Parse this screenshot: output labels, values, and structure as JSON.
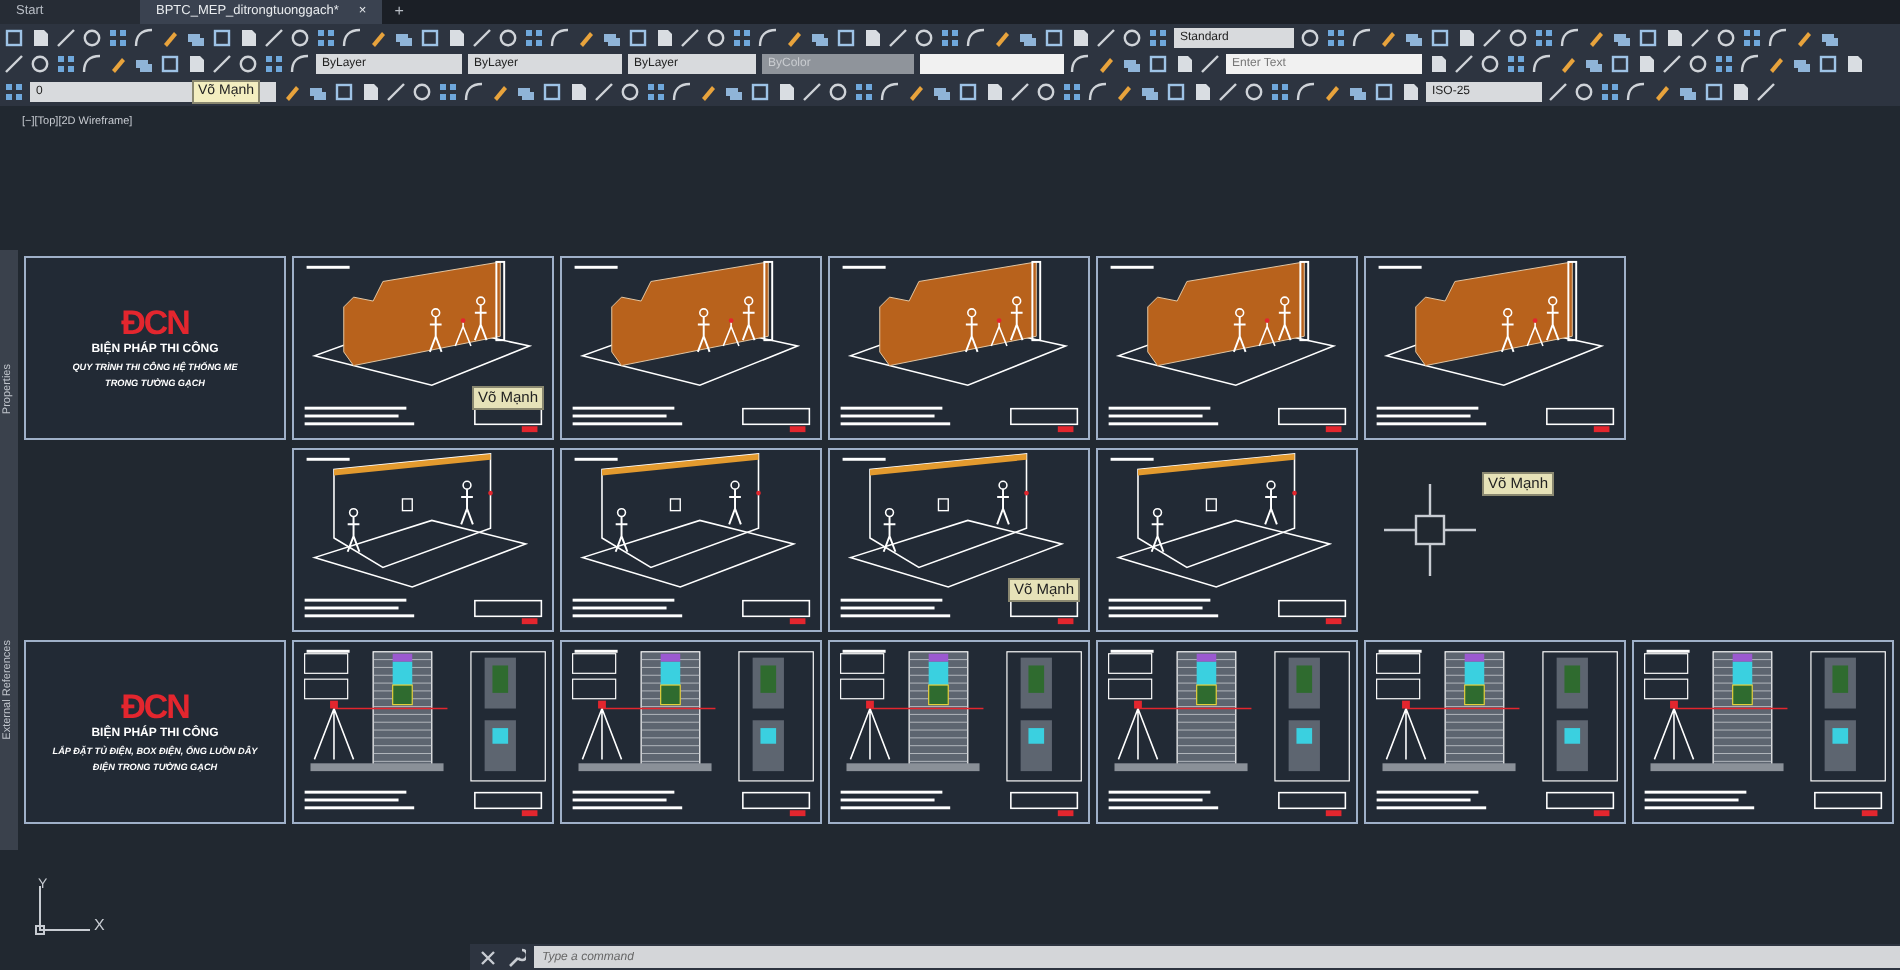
{
  "tabs": [
    {
      "label": "Start",
      "selected": false
    },
    {
      "label": "BPTC_MEP_ditrongtuonggach*",
      "selected": true,
      "close": "×"
    }
  ],
  "new_tab": "+",
  "toolbar": {
    "text_style": "Standard",
    "layer_color": "ByLayer",
    "linetype": "ByLayer",
    "lineweight": "ByLayer",
    "plot_style": {
      "value": "ByColor",
      "disabled": true
    },
    "search": {
      "placeholder": "Enter Text"
    },
    "layer": {
      "name": "0",
      "tooltip": "Võ Mạnh"
    },
    "dim_style": "ISO-25"
  },
  "viewport": {
    "label": "[−][Top][2D Wireframe]"
  },
  "palettes": [
    "Properties",
    "External References"
  ],
  "sheet_rows": [
    {
      "sheets": [
        {
          "kind": "title",
          "logo": "ĐCN",
          "lines": [
            "BIỆN PHÁP THI CÔNG",
            "QUY TRÌNH THI CÔNG HỆ THỐNG ME",
            "TRONG TƯỜNG GẠCH"
          ]
        },
        {
          "kind": "brick_wall",
          "tooltip": "Võ Mạnh"
        },
        {
          "kind": "brick_wall"
        },
        {
          "kind": "brick_wall"
        },
        {
          "kind": "brick_wall"
        },
        {
          "kind": "brick_wall"
        }
      ]
    },
    {
      "sheets": [
        {
          "kind": "blank"
        },
        {
          "kind": "plain_wall"
        },
        {
          "kind": "plain_wall"
        },
        {
          "kind": "plain_wall",
          "tooltip": "Võ Mạnh"
        },
        {
          "kind": "plain_wall"
        }
      ]
    },
    {
      "sheets": [
        {
          "kind": "title",
          "logo": "ĐCN",
          "lines": [
            "BIỆN PHÁP THI CÔNG",
            "LẮP ĐẶT TỦ ĐIỆN, BOX ĐIỆN, ỐNG LUỒN DÂY",
            "ĐIỆN TRONG TƯỜNG GẠCH"
          ]
        },
        {
          "kind": "section"
        },
        {
          "kind": "section"
        },
        {
          "kind": "section"
        },
        {
          "kind": "section"
        },
        {
          "kind": "section"
        },
        {
          "kind": "section"
        }
      ]
    }
  ],
  "cursor": {
    "tooltip": "Võ Mạnh"
  },
  "ucs": {
    "x": "X",
    "y": "Y"
  },
  "command_line": {
    "placeholder": "Type a command"
  }
}
